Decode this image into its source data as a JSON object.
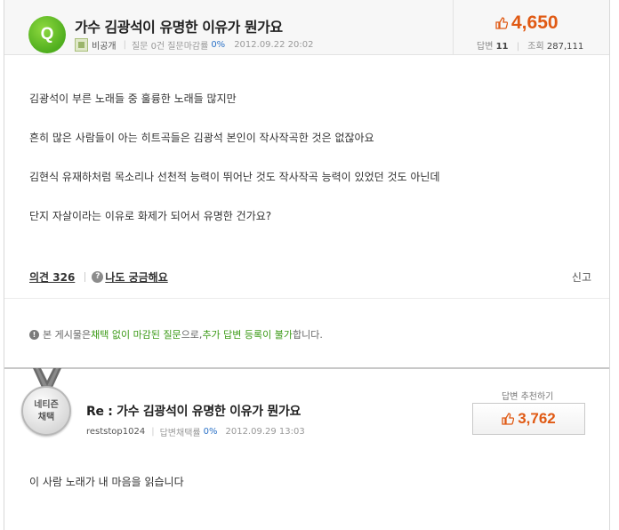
{
  "question": {
    "badge": "Q",
    "title": "가수 김광석이 유명한 이유가 뭔가요",
    "author": "비공개",
    "author_stats_prefix": "질문 0건 질문마감률",
    "close_rate": "0%",
    "date": "2012.09.22 20:02",
    "likes": "4,650",
    "answers_label": "답변",
    "answers_count": "11",
    "views_label": "조회",
    "views_count": "287,111",
    "body": [
      "김광석이 부른 노래들 중 훌륭한 노래들 많지만",
      "흔히 많은 사람들이 아는 히트곡들은 김광석 본인이 작사작곡한 것은 없잖아요",
      "김현식 유재하처럼 목소리나 선천적 능력이 뛰어난 것도 작사작곡 능력이 있었던 것도 아닌데",
      "단지 자살이라는 이유로 화제가 되어서 유명한 건가요?"
    ],
    "opinion_label": "의견 326",
    "curious_icon": "?",
    "curious_label": "나도 궁금해요",
    "report_label": "신고"
  },
  "notice": {
    "icon": "!",
    "part1": "본 게시물은 ",
    "highlight1": "채택 없이 마감된 질문",
    "part2": "으로, ",
    "highlight2": "추가 답변 등록이 불가",
    "part3": "합니다."
  },
  "answer": {
    "medal_line1": "네티즌",
    "medal_line2": "채택",
    "title": "Re : 가수 김광석이 유명한 이유가 뭔가요",
    "user": "reststop1024",
    "adopt_rate_label": "답변채택률",
    "adopt_rate": "0%",
    "date": "2012.09.29 13:03",
    "recommend_label": "답변 추천하기",
    "recommend_count": "3,762",
    "body": "이 사람 노래가 내 마음을 읽습니다"
  },
  "colors": {
    "accent_orange": "#e05a14",
    "accent_green": "#3b9a16",
    "link_blue": "#2c72c7"
  },
  "icons": {
    "question_badge": "q-badge-icon",
    "anonymous_user": "anonymous-user-icon",
    "like": "thumb-up-icon",
    "help": "question-circle-icon",
    "info": "info-circle-icon",
    "medal": "netizen-pick-medal-icon"
  }
}
